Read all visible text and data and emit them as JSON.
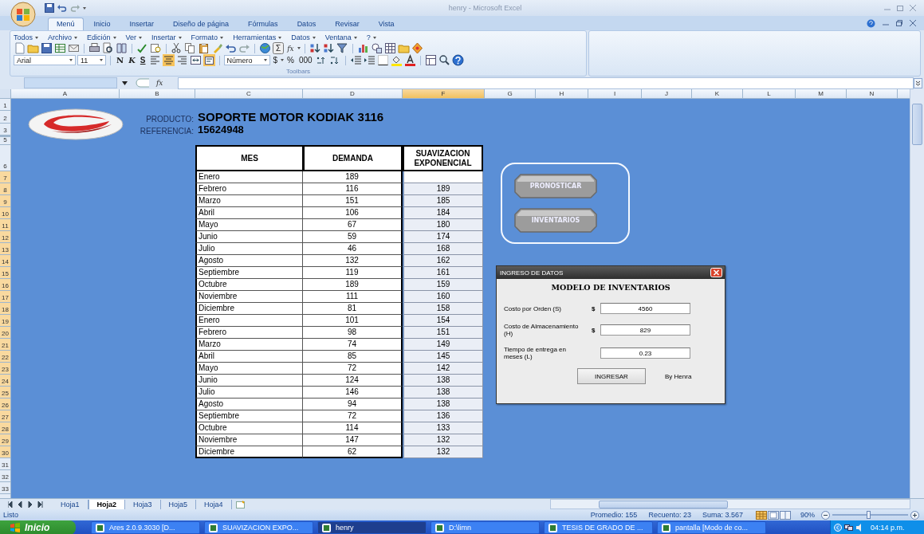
{
  "window": {
    "title": "henry - Microsoft Excel"
  },
  "ribbon_tabs": [
    {
      "label": "Menú",
      "selected": true
    },
    {
      "label": "Inicio",
      "selected": false
    },
    {
      "label": "Insertar",
      "selected": false
    },
    {
      "label": "Diseño de página",
      "selected": false
    },
    {
      "label": "Fórmulas",
      "selected": false
    },
    {
      "label": "Datos",
      "selected": false
    },
    {
      "label": "Revisar",
      "selected": false
    },
    {
      "label": "Vista",
      "selected": false
    }
  ],
  "menus": [
    "Todos",
    "Archivo",
    "Edición",
    "Ver",
    "Insertar",
    "Formato",
    "Herramientas",
    "Datos",
    "Ventana",
    "?"
  ],
  "toolbar": {
    "sum": "Σ",
    "function": "fx",
    "font": "Arial",
    "size": "11",
    "bold": "N",
    "italic": "K",
    "underline": "S",
    "number_format": "Número",
    "currency": "$",
    "percent": "%",
    "thousands": "000",
    "group_label": "Toolbars"
  },
  "formula_bar": {
    "fx": "fx"
  },
  "columns": [
    {
      "label": "A",
      "selected": false
    },
    {
      "label": "B",
      "selected": false
    },
    {
      "label": "C",
      "selected": false
    },
    {
      "label": "D",
      "selected": false
    },
    {
      "label": "F",
      "selected": true
    },
    {
      "label": "G",
      "selected": false
    },
    {
      "label": "H",
      "selected": false
    },
    {
      "label": "I",
      "selected": false
    },
    {
      "label": "J",
      "selected": false
    },
    {
      "label": "K",
      "selected": false
    },
    {
      "label": "L",
      "selected": false
    },
    {
      "label": "M",
      "selected": false
    },
    {
      "label": "N",
      "selected": false
    }
  ],
  "rows": [
    {
      "label": "1",
      "selected": false
    },
    {
      "label": "2",
      "selected": false
    },
    {
      "label": "3",
      "selected": false
    },
    {
      "label": "5",
      "selected": false
    },
    {
      "label": "6",
      "selected": false
    },
    {
      "label": "7",
      "selected": true
    },
    {
      "label": "8",
      "selected": true
    },
    {
      "label": "9",
      "selected": true
    },
    {
      "label": "10",
      "selected": true
    },
    {
      "label": "11",
      "selected": true
    },
    {
      "label": "12",
      "selected": true
    },
    {
      "label": "13",
      "selected": true
    },
    {
      "label": "14",
      "selected": true
    },
    {
      "label": "15",
      "selected": true
    },
    {
      "label": "16",
      "selected": true
    },
    {
      "label": "17",
      "selected": true
    },
    {
      "label": "18",
      "selected": true
    },
    {
      "label": "19",
      "selected": true
    },
    {
      "label": "20",
      "selected": true
    },
    {
      "label": "21",
      "selected": true
    },
    {
      "label": "22",
      "selected": true
    },
    {
      "label": "23",
      "selected": true
    },
    {
      "label": "24",
      "selected": true
    },
    {
      "label": "25",
      "selected": true
    },
    {
      "label": "26",
      "selected": true
    },
    {
      "label": "27",
      "selected": true
    },
    {
      "label": "28",
      "selected": true
    },
    {
      "label": "29",
      "selected": true
    },
    {
      "label": "30",
      "selected": true
    },
    {
      "label": "31",
      "selected": false
    },
    {
      "label": "32",
      "selected": false
    },
    {
      "label": "33",
      "selected": false
    }
  ],
  "product": {
    "label": "PRODUCTO:",
    "value": "SOPORTE MOTOR KODIAK 3116"
  },
  "reference": {
    "label": "REFERENCIA:",
    "value": "15624948"
  },
  "table": {
    "columns": [
      "MES",
      "DEMANDA",
      "SUAVIZACION EXPONENCIAL"
    ],
    "rows": [
      {
        "mes": "Enero",
        "demanda": "189"
      },
      {
        "mes": "Febrero",
        "demanda": "116",
        "suavizacion": "189"
      },
      {
        "mes": "Marzo",
        "demanda": "151",
        "suavizacion": "185"
      },
      {
        "mes": "Abril",
        "demanda": "106",
        "suavizacion": "184"
      },
      {
        "mes": "Mayo",
        "demanda": "67",
        "suavizacion": "180"
      },
      {
        "mes": "Junio",
        "demanda": "59",
        "suavizacion": "174"
      },
      {
        "mes": "Julio",
        "demanda": "46",
        "suavizacion": "168"
      },
      {
        "mes": "Agosto",
        "demanda": "132",
        "suavizacion": "162"
      },
      {
        "mes": "Septiembre",
        "demanda": "119",
        "suavizacion": "161"
      },
      {
        "mes": "Octubre",
        "demanda": "189",
        "suavizacion": "159"
      },
      {
        "mes": "Noviembre",
        "demanda": "111",
        "suavizacion": "160"
      },
      {
        "mes": "Diciembre",
        "demanda": "81",
        "suavizacion": "158"
      },
      {
        "mes": "Enero",
        "demanda": "101",
        "suavizacion": "154"
      },
      {
        "mes": "Febrero",
        "demanda": "98",
        "suavizacion": "151"
      },
      {
        "mes": "Marzo",
        "demanda": "74",
        "suavizacion": "149"
      },
      {
        "mes": "Abril",
        "demanda": "85",
        "suavizacion": "145"
      },
      {
        "mes": "Mayo",
        "demanda": "72",
        "suavizacion": "142"
      },
      {
        "mes": "Junio",
        "demanda": "124",
        "suavizacion": "138"
      },
      {
        "mes": "Julio",
        "demanda": "146",
        "suavizacion": "138"
      },
      {
        "mes": "Agosto",
        "demanda": "94",
        "suavizacion": "138"
      },
      {
        "mes": "Septiembre",
        "demanda": "72",
        "suavizacion": "136"
      },
      {
        "mes": "Octubre",
        "demanda": "114",
        "suavizacion": "133"
      },
      {
        "mes": "Noviembre",
        "demanda": "147",
        "suavizacion": "132"
      },
      {
        "mes": "Diciembre",
        "demanda": "62",
        "suavizacion": "132"
      }
    ]
  },
  "shape_buttons": [
    "PRONOSTICAR",
    "INVENTARIOS"
  ],
  "dialog": {
    "title": "INGRESO DE DATOS",
    "heading": "MODELO DE INVENTARIOS",
    "fields": [
      {
        "label": "Costo por Orden (S)",
        "prefix": "$",
        "value": "4560"
      },
      {
        "label": "Costo de Almacenamiento (H)",
        "prefix": "$",
        "value": "829"
      },
      {
        "label": "Tiempo de entrega en meses (L)",
        "value": "0.23"
      }
    ],
    "button": "INGRESAR",
    "credit": "By Henra"
  },
  "sheet_tabs": [
    {
      "label": "Hoja1",
      "selected": false
    },
    {
      "label": "Hoja2",
      "selected": true
    },
    {
      "label": "Hoja3",
      "selected": false
    },
    {
      "label": "Hoja5",
      "selected": false
    },
    {
      "label": "Hoja4",
      "selected": false
    }
  ],
  "status_bar": {
    "status": "Listo",
    "average": "Promedio: 155",
    "count": "Recuento: 23",
    "sum": "Suma: 3.567",
    "zoom": "90%",
    "zoom_slider": {
      "level": 0.47
    }
  },
  "taskbar": {
    "start": "Inicio",
    "tasks": [
      {
        "label": "Ares 2.0.9.3030  [D...",
        "selected": false
      },
      {
        "label": "SUAVIZACION EXPO...",
        "selected": false
      },
      {
        "label": "henry",
        "selected": true
      },
      {
        "label": "D:\\limn",
        "selected": false
      },
      {
        "label": "TESIS DE GRADO DE ...",
        "selected": false
      },
      {
        "label": "pantalla [Modo de co...",
        "selected": false
      }
    ],
    "clock": "04:14 p.m."
  }
}
